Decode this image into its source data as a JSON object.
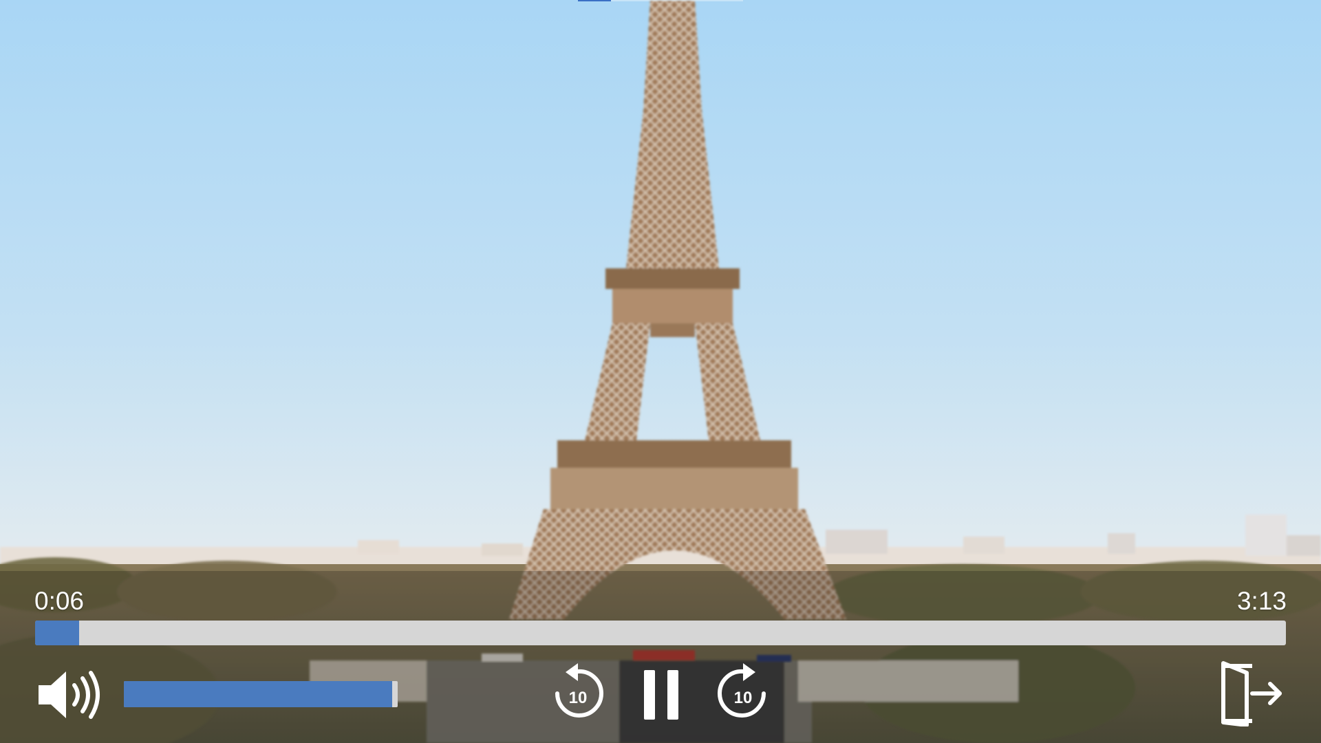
{
  "player": {
    "current_time": "0:06",
    "total_time": "3:13",
    "progress_fraction": 0.035,
    "volume_fraction": 0.98,
    "skip_back_label": "10",
    "skip_forward_label": "10",
    "state": "playing"
  },
  "icons": {
    "volume": "volume-icon",
    "rewind": "rewind-10-icon",
    "pause": "pause-icon",
    "forward": "forward-10-icon",
    "exit": "exit-icon"
  },
  "colors": {
    "accent": "#4a7bbf",
    "track": "#d6d6d6",
    "control_fg": "#ffffff"
  }
}
